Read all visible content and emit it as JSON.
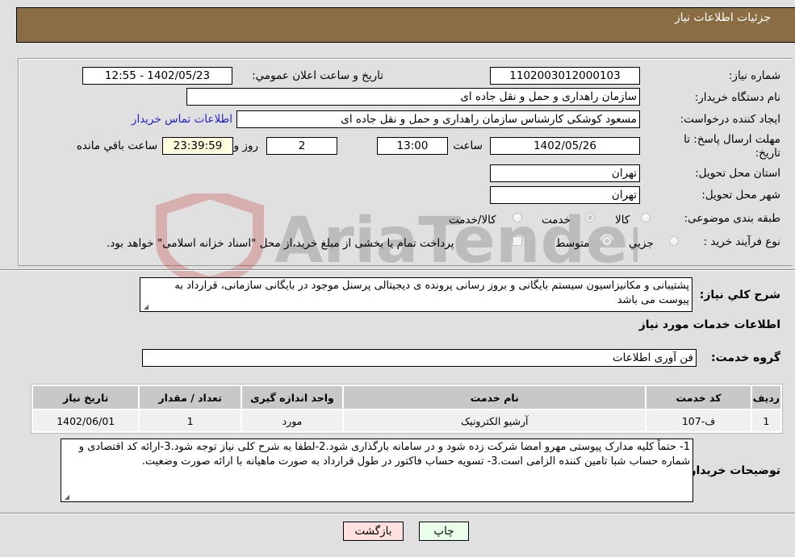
{
  "header": {
    "title": "جزئیات اطلاعات نیاز"
  },
  "form": {
    "need_number_label": "شماره نیاز:",
    "need_number": "1102003012000103",
    "announce_label": "تاریخ و ساعت اعلان عمومي:",
    "announce_value": "1402/05/23 - 12:55",
    "buyer_org_label": "نام دستگاه خريدار:",
    "buyer_org": "سازمان راهداری و حمل و نقل جاده ای",
    "creator_label": "ایجاد کننده درخواست:",
    "creator": "مسعود کوشکی کارشناس  سازمان راهداری و حمل و نقل جاده ای",
    "contact_link": "اطلاعات تماس خریدار",
    "deadline_label_1": "مهلت ارسال پاسخ: تا",
    "deadline_label_2": "تاریخ:",
    "deadline_date": "1402/05/26",
    "time_label": "ساعت",
    "deadline_time": "13:00",
    "days_value": "2",
    "days_label": "روز و",
    "remaining_time": "23:39:59",
    "remaining_label": "ساعت باقي مانده",
    "province_label": "استان محل تحویل:",
    "province": "تهران",
    "city_label": "شهر محل تحویل:",
    "city": "تهران",
    "category_label": "طبقه بندی موضوعی:",
    "category_options": [
      {
        "label": "کالا",
        "checked": false
      },
      {
        "label": "خدمت",
        "checked": true
      },
      {
        "label": "کالا/خدمت",
        "checked": false
      }
    ],
    "process_label": "نوع فرآیند خرید :",
    "process_options": [
      {
        "label": "جزيي",
        "checked": false
      },
      {
        "label": "متوسط",
        "checked": true
      }
    ],
    "treasury_note": "پرداخت تمام یا بخشی از مبلغ خرید،از محل \"اسناد خزانه اسلامی\" خواهد بود."
  },
  "description": {
    "label": "شرح کلي نياز:",
    "text": "پشتیبانی و مکانیزاسیون سیستم بایگانی و بروز رسانی پرونده ی دیجیتالی پرسنل موجود در بایگانی سازمانی، قرارداد به پیوست می باشد"
  },
  "services": {
    "section_title": "اطلاعات خدمات مورد نیاز",
    "group_label": "گروه خدمت:",
    "group_value": "فن آوری اطلاعات",
    "columns": [
      "ردیف",
      "کد خدمت",
      "نام خدمت",
      "واحد اندازه گیری",
      "تعداد / مقدار",
      "تاریخ نیاز"
    ],
    "rows": [
      {
        "row": "1",
        "code": "ف-107",
        "name": "آرشیو الکترونیک",
        "unit": "مورد",
        "qty": "1",
        "date": "1402/06/01"
      }
    ]
  },
  "buyer_notes": {
    "label": "توضیحات خریدار:",
    "text": "1- حتماً کلیه مدارک پیوستی مهرو امضا شرکت زده شود و در سامانه بارگذاری شود.2-لطفا به شرح کلی نیاز توجه شود.3-ارائه کد اقتصادی و شماره حساب شبا تامین کننده الزامی است.3- تسویه حساب فاکتور در طول قرارداد به صورت ماهیانه با ارائه صورت وضعیت."
  },
  "buttons": {
    "print": "چاپ",
    "back": "بازگشت"
  },
  "watermark": {
    "text": "AriaTender.neT"
  }
}
